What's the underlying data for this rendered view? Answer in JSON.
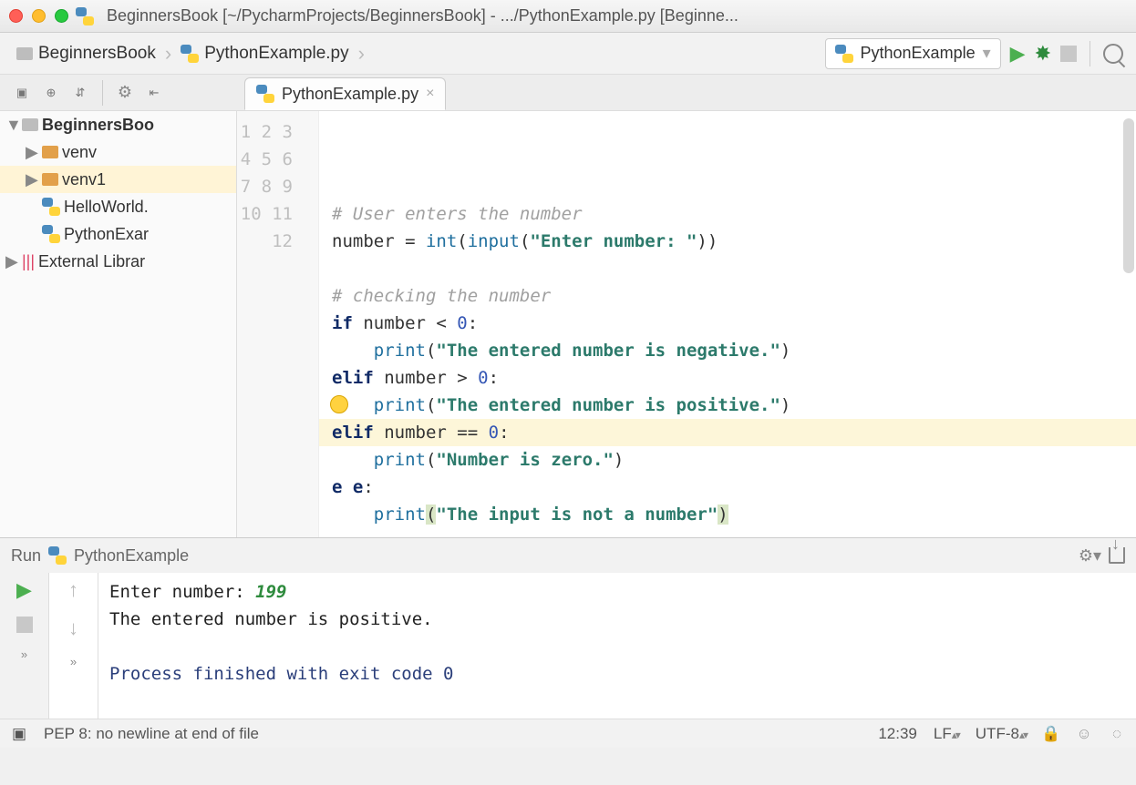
{
  "window": {
    "title": "BeginnersBook [~/PycharmProjects/BeginnersBook] - .../PythonExample.py [Beginne..."
  },
  "breadcrumb": {
    "project": "BeginnersBook",
    "file": "PythonExample.py"
  },
  "runConfig": {
    "selected": "PythonExample"
  },
  "tree": {
    "root": "BeginnersBoo",
    "items": [
      {
        "label": "venv",
        "type": "folder"
      },
      {
        "label": "venv1",
        "type": "folder"
      },
      {
        "label": "HelloWorld.",
        "type": "pyfile"
      },
      {
        "label": "PythonExar",
        "type": "pyfile"
      }
    ],
    "external": "External Librar"
  },
  "tabs": {
    "active": "PythonExample.py"
  },
  "editor": {
    "lines": [
      {
        "n": 1,
        "type": "comment",
        "text": "# User enters the number"
      },
      {
        "n": 2,
        "type": "assign",
        "var": "number",
        "builtin1": "int",
        "builtin2": "input",
        "str": "\"Enter number: \""
      },
      {
        "n": 3,
        "type": "blank"
      },
      {
        "n": 4,
        "type": "comment",
        "text": "# checking the number"
      },
      {
        "n": 5,
        "type": "if",
        "kw": "if",
        "expr": " number < ",
        "num": "0",
        "colon": ":"
      },
      {
        "n": 6,
        "type": "print",
        "builtin": "print",
        "str": "\"The entered number is negative.\""
      },
      {
        "n": 7,
        "type": "if",
        "kw": "elif",
        "expr": " number > ",
        "num": "0",
        "colon": ":"
      },
      {
        "n": 8,
        "type": "print",
        "builtin": "print",
        "str": "\"The entered number is positive.\""
      },
      {
        "n": 9,
        "type": "if",
        "kw": "elif",
        "expr": " number == ",
        "num": "0",
        "colon": ":"
      },
      {
        "n": 10,
        "type": "print",
        "builtin": "print",
        "str": "\"Number is zero.\""
      },
      {
        "n": 11,
        "type": "else",
        "pre": "e",
        "post": "e",
        "colon": ":"
      },
      {
        "n": 12,
        "type": "print_hl",
        "builtin": "print",
        "str": "\"The input is not a number\""
      }
    ],
    "cursorLine": 12
  },
  "runPanel": {
    "title": "Run",
    "config": "PythonExample"
  },
  "console": {
    "prompt": "Enter number: ",
    "input": "199",
    "output": "The entered number is positive.",
    "exit": "Process finished with exit code 0"
  },
  "status": {
    "pep8": "PEP 8: no newline at end of file",
    "cursor": "12:39",
    "lineSep": "LF",
    "encoding": "UTF-8"
  }
}
